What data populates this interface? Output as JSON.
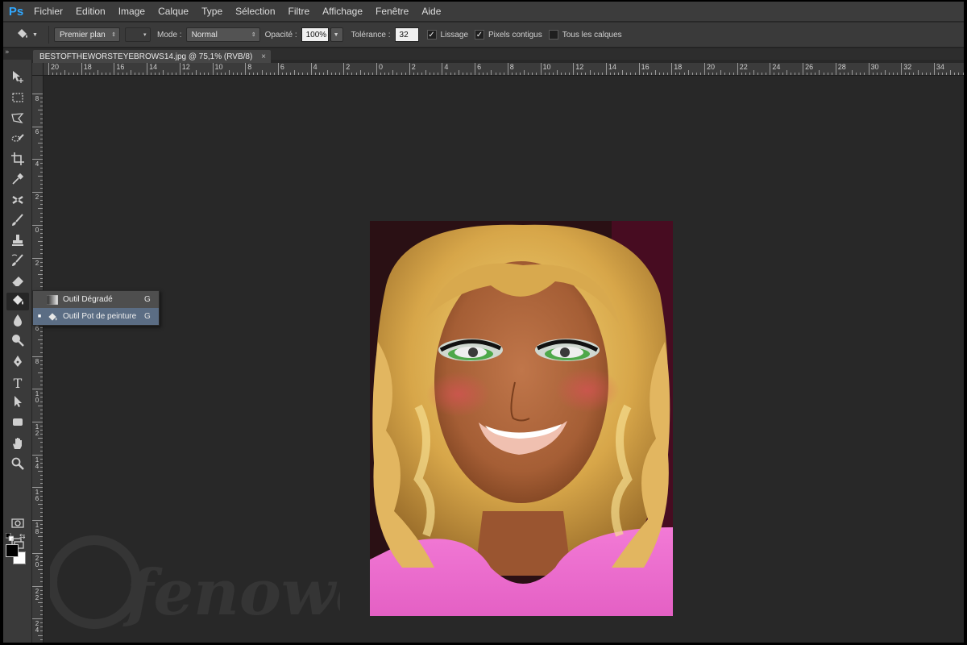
{
  "app": {
    "logo": "Ps"
  },
  "menu": [
    "Fichier",
    "Edition",
    "Image",
    "Calque",
    "Type",
    "Sélection",
    "Filtre",
    "Affichage",
    "Fenêtre",
    "Aide"
  ],
  "options": {
    "tool_icon": "paint-bucket-icon",
    "fill_source": "Premier plan",
    "mode_label": "Mode :",
    "mode_value": "Normal",
    "opacity_label": "Opacité :",
    "opacity_value": "100%",
    "tolerance_label": "Tolérance :",
    "tolerance_value": "32",
    "antialias_label": "Lissage",
    "antialias_checked": true,
    "contiguous_label": "Pixels contigus",
    "contiguous_checked": true,
    "all_layers_label": "Tous les calques",
    "all_layers_checked": false
  },
  "document": {
    "tab_title": "BESTOFTHEWORSTEYEBROWS14.jpg @ 75,1% (RVB/8)",
    "close_symbol": "×"
  },
  "ruler_h_labels": [
    "20",
    "18",
    "16",
    "14",
    "12",
    "10",
    "8",
    "6",
    "4",
    "2",
    "0",
    "2",
    "4",
    "6",
    "8",
    "10",
    "12",
    "14",
    "16",
    "18",
    "20",
    "22",
    "24",
    "26",
    "28",
    "30",
    "32",
    "34"
  ],
  "ruler_v_labels": [
    "8",
    "6",
    "4",
    "2",
    "0",
    "2",
    "4",
    "6",
    "8",
    "10",
    "12",
    "14",
    "16",
    "18",
    "20",
    "22",
    "24"
  ],
  "flyout": {
    "items": [
      {
        "label": "Outil Dégradé",
        "key": "G",
        "icon": "gradient-icon",
        "selected": false
      },
      {
        "label": "Outil Pot de peinture",
        "key": "G",
        "icon": "paint-bucket-icon",
        "selected": true
      }
    ]
  },
  "watermark": "fenoweb",
  "colors": {
    "foreground": "#000000",
    "background": "#ffffff",
    "accent": "#31a8ff",
    "flyout_selected": "#5b6d84"
  }
}
